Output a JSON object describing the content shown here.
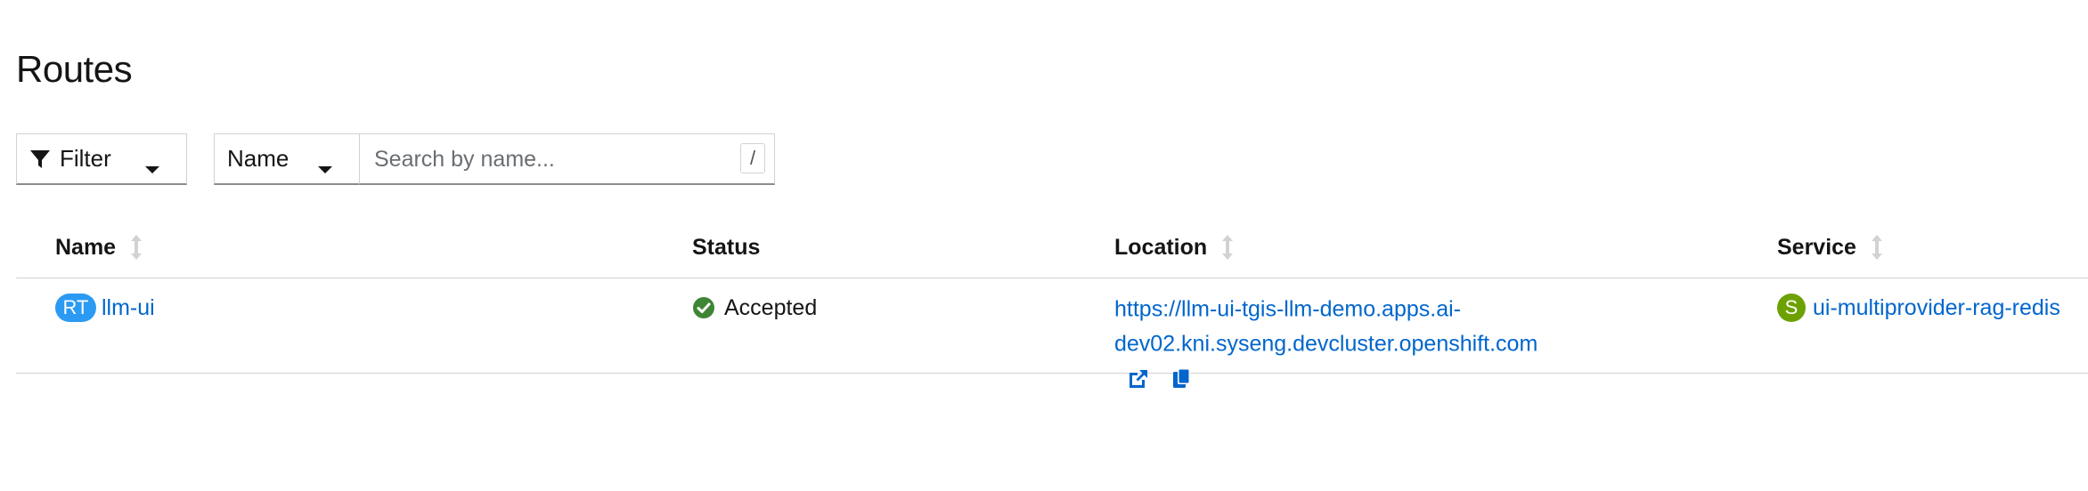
{
  "page": {
    "title": "Routes"
  },
  "toolbar": {
    "filter_label": "Filter",
    "filter_type_label": "Name",
    "search_placeholder": "Search by name...",
    "search_value": "",
    "search_shortcut": "/"
  },
  "table": {
    "columns": [
      {
        "label": "Name",
        "sortable": true
      },
      {
        "label": "Status",
        "sortable": false
      },
      {
        "label": "Location",
        "sortable": true
      },
      {
        "label": "Service",
        "sortable": true
      }
    ],
    "rows": [
      {
        "kind_badge": "RT",
        "name": "llm-ui",
        "status": "Accepted",
        "status_icon": "check-circle-icon",
        "location_line1": "https://llm-ui-tgis-llm-demo.apps.ai-",
        "location_line2": "dev02.kni.syseng.devcluster.openshift.com",
        "service_badge": "S",
        "service": "ui-multiprovider-rag-redis"
      }
    ]
  },
  "colors": {
    "link": "#0066cc",
    "route_badge": "#2b9af3",
    "service_badge": "#6ca100",
    "success": "#3e8635",
    "border": "#d2d2d2"
  }
}
